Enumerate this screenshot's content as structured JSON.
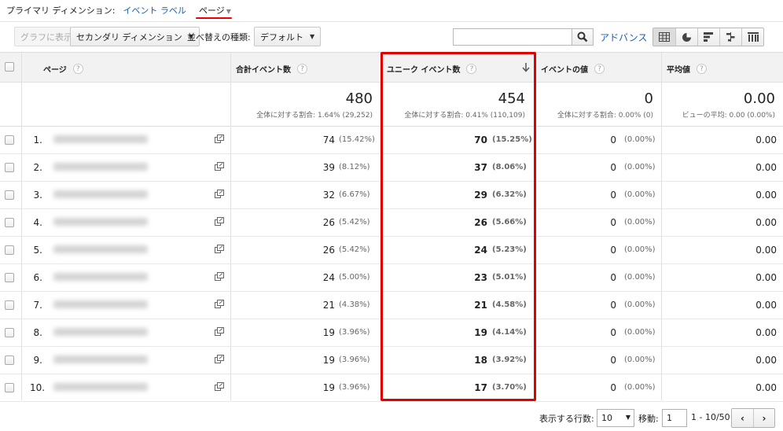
{
  "primary_dimension": {
    "label": "プライマリ ディメンション:",
    "options": [
      "イベント ラベル",
      "ページ"
    ],
    "active": "ページ"
  },
  "toolbar": {
    "plot_button": "グラフに表示",
    "secondary_dimension": "セカンダリ ディメンション",
    "sort_label": "並べ替えの種類:",
    "sort_value": "デフォルト",
    "search_placeholder": "",
    "advanced": "アドバンス",
    "view_icons": [
      "table-view-icon",
      "pie-view-icon",
      "bar-view-icon",
      "comparison-view-icon",
      "pivot-view-icon"
    ]
  },
  "columns": {
    "page": "ページ",
    "total_events": "合計イベント数",
    "unique_events": "ユニーク イベント数",
    "event_value": "イベントの値",
    "avg_value": "平均値"
  },
  "totals": {
    "total_events": {
      "value": "480",
      "sub": "全体に対する割合: 1.64% (29,252)"
    },
    "unique_events": {
      "value": "454",
      "sub": "全体に対する割合: 0.41% (110,109)"
    },
    "event_value": {
      "value": "0",
      "sub": "全体に対する割合: 0.00% (0)"
    },
    "avg_value": {
      "value": "0.00",
      "sub": "ビューの平均: 0.00 (0.00%)"
    }
  },
  "rows": [
    {
      "idx": "1.",
      "total": "74",
      "total_pct": "(15.42%)",
      "unique": "70",
      "unique_pct": "(15.25%)",
      "value": "0",
      "value_pct": "(0.00%)",
      "avg": "0.00"
    },
    {
      "idx": "2.",
      "total": "39",
      "total_pct": "(8.12%)",
      "unique": "37",
      "unique_pct": "(8.06%)",
      "value": "0",
      "value_pct": "(0.00%)",
      "avg": "0.00"
    },
    {
      "idx": "3.",
      "total": "32",
      "total_pct": "(6.67%)",
      "unique": "29",
      "unique_pct": "(6.32%)",
      "value": "0",
      "value_pct": "(0.00%)",
      "avg": "0.00"
    },
    {
      "idx": "4.",
      "total": "26",
      "total_pct": "(5.42%)",
      "unique": "26",
      "unique_pct": "(5.66%)",
      "value": "0",
      "value_pct": "(0.00%)",
      "avg": "0.00"
    },
    {
      "idx": "5.",
      "total": "26",
      "total_pct": "(5.42%)",
      "unique": "24",
      "unique_pct": "(5.23%)",
      "value": "0",
      "value_pct": "(0.00%)",
      "avg": "0.00"
    },
    {
      "idx": "6.",
      "total": "24",
      "total_pct": "(5.00%)",
      "unique": "23",
      "unique_pct": "(5.01%)",
      "value": "0",
      "value_pct": "(0.00%)",
      "avg": "0.00"
    },
    {
      "idx": "7.",
      "total": "21",
      "total_pct": "(4.38%)",
      "unique": "21",
      "unique_pct": "(4.58%)",
      "value": "0",
      "value_pct": "(0.00%)",
      "avg": "0.00"
    },
    {
      "idx": "8.",
      "total": "19",
      "total_pct": "(3.96%)",
      "unique": "19",
      "unique_pct": "(4.14%)",
      "value": "0",
      "value_pct": "(0.00%)",
      "avg": "0.00"
    },
    {
      "idx": "9.",
      "total": "19",
      "total_pct": "(3.96%)",
      "unique": "18",
      "unique_pct": "(3.92%)",
      "value": "0",
      "value_pct": "(0.00%)",
      "avg": "0.00"
    },
    {
      "idx": "10.",
      "total": "19",
      "total_pct": "(3.96%)",
      "unique": "17",
      "unique_pct": "(3.70%)",
      "value": "0",
      "value_pct": "(0.00%)",
      "avg": "0.00"
    }
  ],
  "footer": {
    "rows_label": "表示する行数:",
    "rows_value": "10",
    "goto_label": "移動:",
    "goto_value": "1",
    "range": "1 - 10/50",
    "prev": "‹",
    "next": "›"
  },
  "colors": {
    "highlight": "#e00000",
    "link": "#1a5fb4"
  }
}
